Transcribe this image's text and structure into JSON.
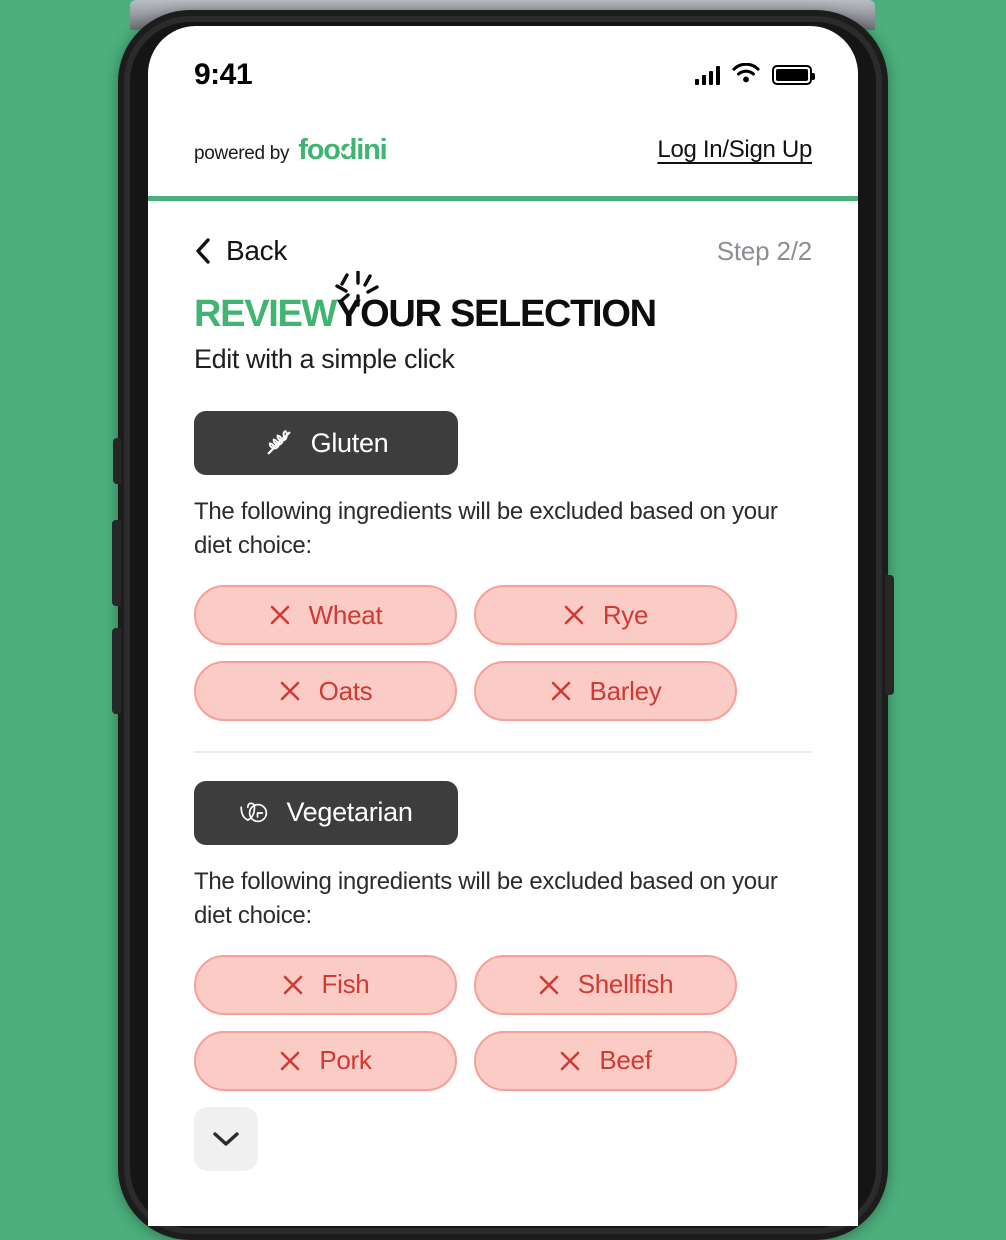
{
  "background_color": "#4caf7d",
  "status_bar": {
    "time": "9:41",
    "cellular_icon": "cellular-signal-icon",
    "wifi_icon": "wifi-icon",
    "battery_icon": "battery-full-icon"
  },
  "header": {
    "powered_by": "powered by",
    "brand": "foodini",
    "brand_color": "#3fb571",
    "login_link": "Log In/Sign Up",
    "accent_bar_color": "#4caf7d"
  },
  "nav": {
    "back_label": "Back",
    "back_icon": "chevron-left-icon",
    "step_indicator": "Step 2/2"
  },
  "title": {
    "accent_word": "REVIEW",
    "rest": " YOUR SELECTION",
    "burst_icon": "click-burst-icon",
    "subtitle": "Edit with a simple click"
  },
  "sections": [
    {
      "diet": "Gluten",
      "diet_icon": "no-wheat-icon",
      "note": "The following ingredients will be excluded based on your diet choice:",
      "exclusions": [
        "Wheat",
        "Rye",
        "Oats",
        "Barley"
      ],
      "has_expand": false
    },
    {
      "diet": "Vegetarian",
      "diet_icon": "vg-monogram-icon",
      "note": "The following ingredients will be excluded based on your diet choice:",
      "exclusions": [
        "Fish",
        "Shellfish",
        "Pork",
        "Beef"
      ],
      "has_expand": true,
      "expand_icon": "chevron-down-icon"
    }
  ],
  "colors": {
    "chip_bg": "#fbcbc6",
    "chip_border": "#f79f98",
    "chip_text": "#cf3b34",
    "diet_chip_bg": "#3d3d3d"
  }
}
